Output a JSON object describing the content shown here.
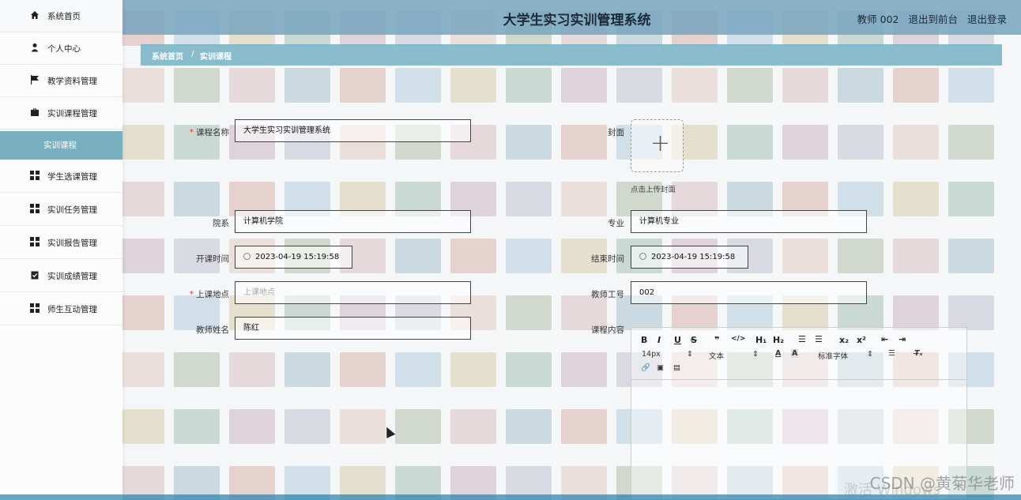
{
  "header": {
    "title": "大学生实习实训管理系统",
    "user": "教师 002",
    "to_front": "退出到前台",
    "logout": "退出登录"
  },
  "breadcrumb": {
    "home": "系统首页",
    "current": "实训课程"
  },
  "sidebar": {
    "items": [
      {
        "label": "系统首页",
        "icon": "home-icon"
      },
      {
        "label": "个人中心",
        "icon": "user-icon"
      },
      {
        "label": "教学资料管理",
        "icon": "flag-icon"
      },
      {
        "label": "实训课程管理",
        "icon": "briefcase-icon"
      },
      {
        "label": "学生选课管理",
        "icon": "grid-icon"
      },
      {
        "label": "实训任务管理",
        "icon": "grid-icon"
      },
      {
        "label": "实训报告管理",
        "icon": "grid-icon"
      },
      {
        "label": "实训成绩管理",
        "icon": "clipboard-icon"
      },
      {
        "label": "师生互动管理",
        "icon": "grid-icon"
      }
    ],
    "sub_active": "实训课程"
  },
  "form": {
    "course_name": {
      "label": "课程名称",
      "value": "大学生实习实训管理系统",
      "required": true
    },
    "cover": {
      "label": "封面",
      "tip": "点击上传封面"
    },
    "department": {
      "label": "院系",
      "value": "计算机学院"
    },
    "major": {
      "label": "专业",
      "value": "计算机专业"
    },
    "start_time": {
      "label": "开课时间",
      "value": "2023-04-19 15:19:58"
    },
    "end_time": {
      "label": "结束时间",
      "value": "2023-04-19 15:19:58"
    },
    "location": {
      "label": "上课地点",
      "placeholder": "上课地点",
      "required": true
    },
    "teacher_no": {
      "label": "教师工号",
      "value": "002"
    },
    "teacher_name": {
      "label": "教师姓名",
      "value": "陈红"
    },
    "content": {
      "label": "课程内容"
    }
  },
  "editor": {
    "font_size": "14px",
    "block": "文本",
    "font_family": "标准字体"
  },
  "watermark": "CSDN @黄菊华老师",
  "watermark_os": "激活 Windows"
}
